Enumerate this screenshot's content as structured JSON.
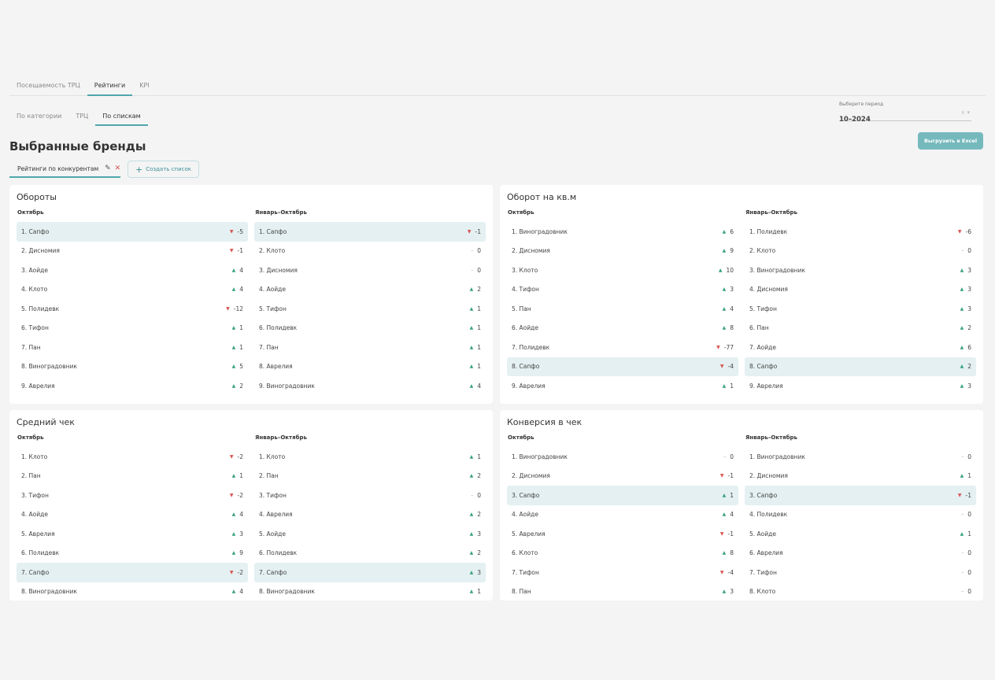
{
  "nav": {
    "tabs": [
      "Посещаемость ТРЦ",
      "Рейтинги",
      "KPI"
    ]
  },
  "subnav": {
    "tabs": [
      "По категории",
      "ТРЦ",
      "По спискам"
    ]
  },
  "period": {
    "label": "Выберите период",
    "value": "10–2024",
    "clear": "×",
    "dropdown": "▾"
  },
  "page_title": "Выбранные бренды",
  "export_button": "Выгрузить в Excel",
  "list_tab": {
    "label": "Рейтинги по конкурентам",
    "edit": "✎",
    "close": "✕"
  },
  "create_button": {
    "plus": "+",
    "label": "Создать список"
  },
  "panels": [
    {
      "title": "Обороты",
      "columns": [
        {
          "header": "Октябрь",
          "rows": [
            {
              "name": "1. Сапфо",
              "dir": "down",
              "value": "-5",
              "hl": true
            },
            {
              "name": "2. Дисномия",
              "dir": "down",
              "value": "-1"
            },
            {
              "name": "3. Аойде",
              "dir": "up",
              "value": "4"
            },
            {
              "name": "4. Клото",
              "dir": "up",
              "value": "4"
            },
            {
              "name": "5. Полидевк",
              "dir": "down",
              "value": "-12"
            },
            {
              "name": "6. Тифон",
              "dir": "up",
              "value": "1"
            },
            {
              "name": "7. Пан",
              "dir": "up",
              "value": "1"
            },
            {
              "name": "8. Виноградовник",
              "dir": "up",
              "value": "5"
            },
            {
              "name": "9. Аврелия",
              "dir": "up",
              "value": "2"
            }
          ]
        },
        {
          "header": "Январь–Октябрь",
          "rows": [
            {
              "name": "1. Сапфо",
              "dir": "down",
              "value": "-1",
              "hl": true
            },
            {
              "name": "2. Клото",
              "dir": "flat",
              "value": "0"
            },
            {
              "name": "3. Дисномия",
              "dir": "flat",
              "value": "0"
            },
            {
              "name": "4. Аойде",
              "dir": "up",
              "value": "2"
            },
            {
              "name": "5. Тифон",
              "dir": "up",
              "value": "1"
            },
            {
              "name": "6. Полидевк",
              "dir": "up",
              "value": "1"
            },
            {
              "name": "7. Пан",
              "dir": "up",
              "value": "1"
            },
            {
              "name": "8. Аврелия",
              "dir": "up",
              "value": "1"
            },
            {
              "name": "9. Виноградовник",
              "dir": "up",
              "value": "4"
            }
          ]
        }
      ]
    },
    {
      "title": "Оборот на кв.м",
      "columns": [
        {
          "header": "Октябрь",
          "rows": [
            {
              "name": "1. Виноградовник",
              "dir": "up",
              "value": "6"
            },
            {
              "name": "2. Дисномия",
              "dir": "up",
              "value": "9"
            },
            {
              "name": "3. Клото",
              "dir": "up",
              "value": "10"
            },
            {
              "name": "4. Тифон",
              "dir": "up",
              "value": "3"
            },
            {
              "name": "5. Пан",
              "dir": "up",
              "value": "4"
            },
            {
              "name": "6. Аойде",
              "dir": "up",
              "value": "8"
            },
            {
              "name": "7. Полидевк",
              "dir": "down",
              "value": "-77"
            },
            {
              "name": "8. Сапфо",
              "dir": "down",
              "value": "-4",
              "hl": true
            },
            {
              "name": "9. Аврелия",
              "dir": "up",
              "value": "1"
            }
          ]
        },
        {
          "header": "Январь–Октябрь",
          "rows": [
            {
              "name": "1. Полидевк",
              "dir": "down",
              "value": "-6"
            },
            {
              "name": "2. Клото",
              "dir": "flat",
              "value": "0"
            },
            {
              "name": "3. Виноградовник",
              "dir": "up",
              "value": "3"
            },
            {
              "name": "4. Дисномия",
              "dir": "up",
              "value": "3"
            },
            {
              "name": "5. Тифон",
              "dir": "up",
              "value": "3"
            },
            {
              "name": "6. Пан",
              "dir": "up",
              "value": "2"
            },
            {
              "name": "7. Аойде",
              "dir": "up",
              "value": "6"
            },
            {
              "name": "8. Сапфо",
              "dir": "up",
              "value": "2",
              "hl": true
            },
            {
              "name": "9. Аврелия",
              "dir": "up",
              "value": "3"
            }
          ]
        }
      ]
    },
    {
      "title": "Средний чек",
      "columns": [
        {
          "header": "Октябрь",
          "rows": [
            {
              "name": "1. Клото",
              "dir": "down",
              "value": "-2"
            },
            {
              "name": "2. Пан",
              "dir": "up",
              "value": "1"
            },
            {
              "name": "3. Тифон",
              "dir": "down",
              "value": "-2"
            },
            {
              "name": "4. Аойде",
              "dir": "up",
              "value": "4"
            },
            {
              "name": "5. Аврелия",
              "dir": "up",
              "value": "3"
            },
            {
              "name": "6. Полидевк",
              "dir": "up",
              "value": "9"
            },
            {
              "name": "7. Сапфо",
              "dir": "down",
              "value": "-2",
              "hl": true
            },
            {
              "name": "8. Виноградовник",
              "dir": "up",
              "value": "4"
            }
          ]
        },
        {
          "header": "Январь–Октябрь",
          "rows": [
            {
              "name": "1. Клото",
              "dir": "up",
              "value": "1"
            },
            {
              "name": "2. Пан",
              "dir": "up",
              "value": "2"
            },
            {
              "name": "3. Тифон",
              "dir": "flat",
              "value": "0"
            },
            {
              "name": "4. Аврелия",
              "dir": "up",
              "value": "2"
            },
            {
              "name": "5. Аойде",
              "dir": "up",
              "value": "3"
            },
            {
              "name": "6. Полидевк",
              "dir": "up",
              "value": "2"
            },
            {
              "name": "7. Сапфо",
              "dir": "up",
              "value": "3",
              "hl": true
            },
            {
              "name": "8. Виноградовник",
              "dir": "up",
              "value": "1"
            }
          ]
        }
      ]
    },
    {
      "title": "Конверсия в чек",
      "columns": [
        {
          "header": "Октябрь",
          "rows": [
            {
              "name": "1. Виноградовник",
              "dir": "flat",
              "value": "0"
            },
            {
              "name": "2. Дисномия",
              "dir": "down",
              "value": "-1"
            },
            {
              "name": "3. Сапфо",
              "dir": "up",
              "value": "1",
              "hl": true
            },
            {
              "name": "4. Аойде",
              "dir": "up",
              "value": "4"
            },
            {
              "name": "5. Аврелия",
              "dir": "down",
              "value": "-1"
            },
            {
              "name": "6. Клото",
              "dir": "up",
              "value": "8"
            },
            {
              "name": "7. Тифон",
              "dir": "down",
              "value": "-4"
            },
            {
              "name": "8. Пан",
              "dir": "up",
              "value": "3"
            }
          ]
        },
        {
          "header": "Январь–Октябрь",
          "rows": [
            {
              "name": "1. Виноградовник",
              "dir": "flat",
              "value": "0"
            },
            {
              "name": "2. Дисномия",
              "dir": "up",
              "value": "1"
            },
            {
              "name": "3. Сапфо",
              "dir": "down",
              "value": "-1",
              "hl": true
            },
            {
              "name": "4. Полидевк",
              "dir": "flat",
              "value": "0"
            },
            {
              "name": "5. Аойде",
              "dir": "up",
              "value": "1"
            },
            {
              "name": "6. Аврелия",
              "dir": "flat",
              "value": "0"
            },
            {
              "name": "7. Тифон",
              "dir": "flat",
              "value": "0"
            },
            {
              "name": "8. Клото",
              "dir": "flat",
              "value": "0"
            }
          ]
        }
      ]
    }
  ]
}
